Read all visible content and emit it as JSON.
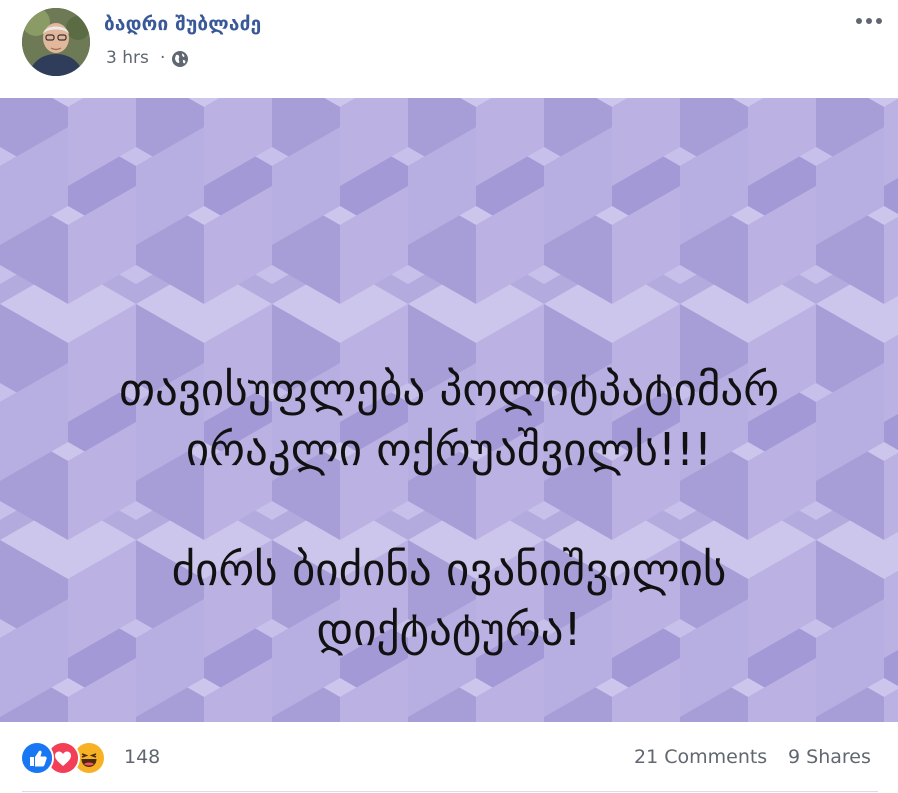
{
  "post": {
    "author": "ბადრი შუბლაძე",
    "timestamp": "3 hrs",
    "separator": "·",
    "privacy_icon": "globe-icon",
    "more_icon": "more-options-icon",
    "image_text": {
      "line1": "თავისუფლება პოლიტპატიმარ",
      "line2": "ირაკლი ოქრუაშვილს!!!",
      "line3": "ძირს ბიძინა ივანიშვილის",
      "line4": "დიქტატურა!"
    },
    "image_bg_color": "#b6addf"
  },
  "footer": {
    "reactions": [
      "like-icon",
      "love-icon",
      "haha-icon"
    ],
    "reaction_count": "148",
    "comments": "21 Comments",
    "shares": "9 Shares"
  },
  "colors": {
    "name": "#385898",
    "meta": "#606770",
    "like": "#1877f2",
    "love": "#f33e58",
    "haha": "#f7b125"
  }
}
